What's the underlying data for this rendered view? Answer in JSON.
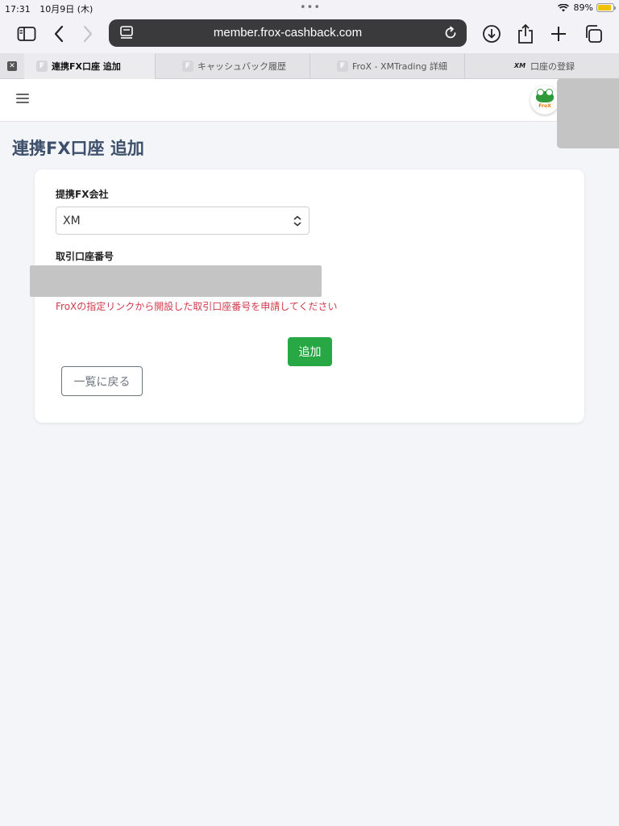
{
  "status_bar": {
    "time": "17:31",
    "date": "10月9日 (木)",
    "battery": "89%",
    "battery_level": 0.89,
    "battery_color": "#f2c200"
  },
  "browser": {
    "url": "member.frox-cashback.com",
    "icons": [
      "sidebar-icon",
      "back-icon",
      "forward-icon",
      "page-menu-icon",
      "reload-icon",
      "download-icon",
      "share-icon",
      "new-tab-icon",
      "tabs-overview-icon"
    ],
    "tabs": [
      {
        "label": "連携FX口座 追加",
        "favicon": "F",
        "active": true
      },
      {
        "label": "キャッシュバック履歴",
        "favicon": "F",
        "active": false
      },
      {
        "label": "FroX - XMTrading 詳細",
        "favicon": "F",
        "active": false
      },
      {
        "label": "口座の登録",
        "favicon": "XM",
        "active": false
      }
    ]
  },
  "page": {
    "title": "連携FX口座 追加",
    "form": {
      "company_label": "提携FX会社",
      "company_selected": "XM",
      "account_label": "取引口座番号",
      "error_message": "FroXの指定リンクから開設した取引口座番号を申請してください",
      "submit_label": "追加",
      "back_label": "一覧に戻る"
    }
  },
  "colors": {
    "accent_green": "#28a745",
    "error_red": "#d13a4a",
    "title_blue": "#3d4f6a",
    "page_bg": "#f4f5f8"
  }
}
